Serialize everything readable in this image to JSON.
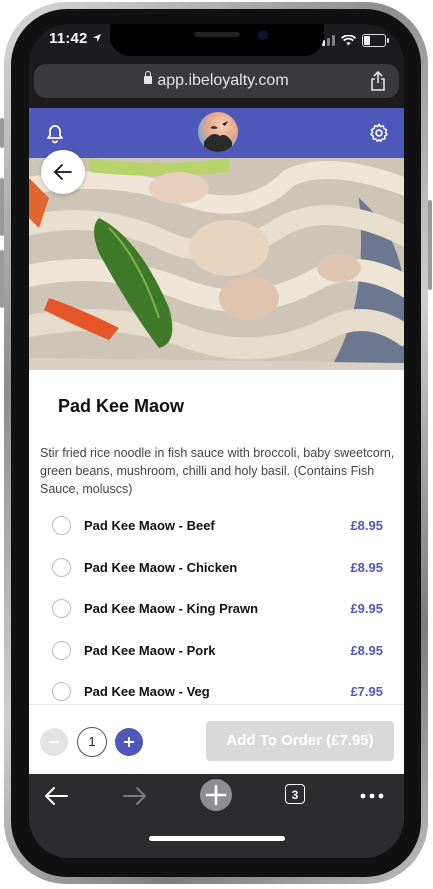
{
  "status_bar": {
    "time": "11:42"
  },
  "browser": {
    "url": "app.ibeloyalty.com",
    "tabs_count": "3"
  },
  "colors": {
    "brand": "#4e58b8",
    "price": "#5058b8",
    "disabled_button": "#d9d9d9"
  },
  "header": {
    "icons": [
      "bell-icon",
      "restaurant-logo",
      "gear-icon"
    ]
  },
  "dish": {
    "title": "Pad Kee Maow",
    "description": "Stir fried rice noodle in fish sauce with broccoli, baby sweetcorn, green beans, mushroom, chilli and holy basil. (Contains Fish Sauce, moluscs)",
    "options": [
      {
        "name": "Pad Kee Maow - Beef",
        "price": "£8.95"
      },
      {
        "name": "Pad Kee Maow - Chicken",
        "price": "£8.95"
      },
      {
        "name": "Pad Kee Maow - King Prawn",
        "price": "£9.95"
      },
      {
        "name": "Pad Kee Maow - Pork",
        "price": "£8.95"
      },
      {
        "name": "Pad Kee Maow - Veg",
        "price": "£7.95"
      }
    ]
  },
  "order": {
    "quantity": "1",
    "add_button_label": "Add To Order (£7.95)"
  }
}
